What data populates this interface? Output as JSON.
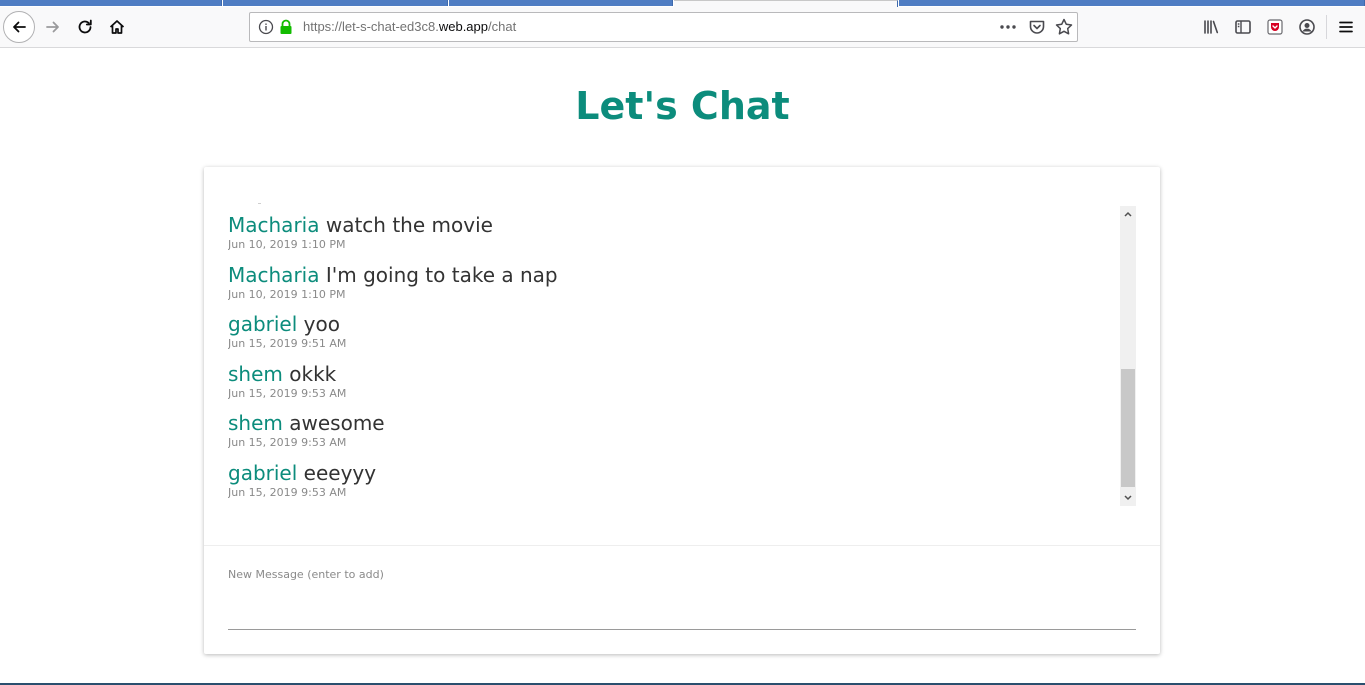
{
  "browser": {
    "url_prefix": "https://let-s-chat-ed3c8.",
    "url_host": "web.app",
    "url_path": "/chat",
    "icons": [
      "back-icon",
      "forward-icon",
      "reload-icon",
      "home-icon",
      "info-icon",
      "lock-icon",
      "more-icon",
      "pocket-icon",
      "star-icon",
      "library-icon",
      "sidebar-icon",
      "account-icon",
      "menu-icon"
    ]
  },
  "page": {
    "title": "Let's Chat"
  },
  "messages": [
    {
      "author": "Macharia",
      "text": "watch the movie",
      "time": "Jun 10, 2019 1:10 PM"
    },
    {
      "author": "Macharia",
      "text": "I'm going to take a nap",
      "time": "Jun 10, 2019 1:10 PM"
    },
    {
      "author": "gabriel",
      "text": "yoo",
      "time": "Jun 15, 2019 9:51 AM"
    },
    {
      "author": "shem",
      "text": "okkk",
      "time": "Jun 15, 2019 9:53 AM"
    },
    {
      "author": "shem",
      "text": "awesome",
      "time": "Jun 15, 2019 9:53 AM"
    },
    {
      "author": "gabriel",
      "text": "eeeyyy",
      "time": "Jun 15, 2019 9:53 AM"
    }
  ],
  "composer": {
    "label": "New Message (enter to add)",
    "value": ""
  },
  "colors": {
    "accent": "#0c8c7c",
    "text": "#333333",
    "muted": "#8a8a8a"
  }
}
